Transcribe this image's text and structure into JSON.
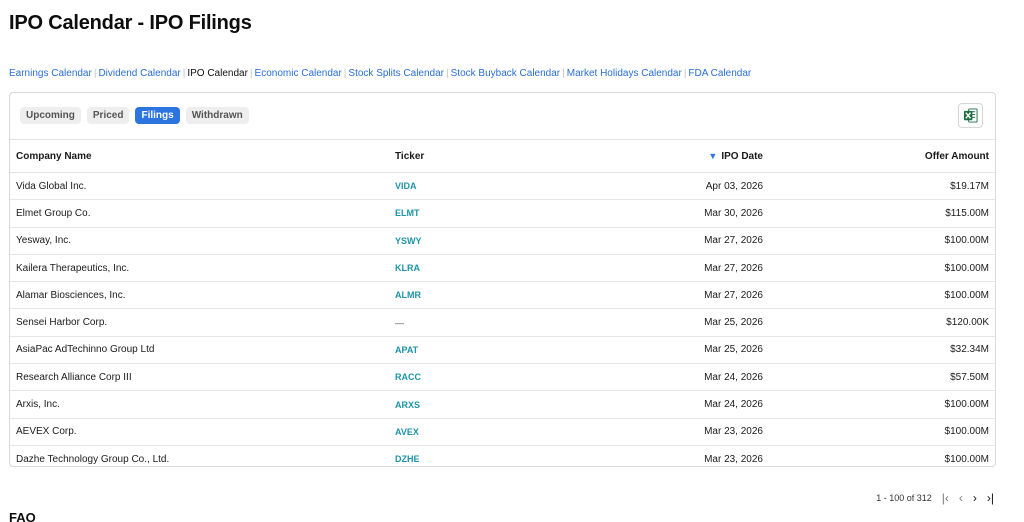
{
  "page": {
    "title": "IPO Calendar - IPO Filings"
  },
  "nav": [
    {
      "label": "Earnings Calendar",
      "active": false
    },
    {
      "label": "Dividend Calendar",
      "active": false
    },
    {
      "label": "IPO Calendar",
      "active": true
    },
    {
      "label": "Economic Calendar",
      "active": false
    },
    {
      "label": "Stock Splits Calendar",
      "active": false
    },
    {
      "label": "Stock Buyback Calendar",
      "active": false
    },
    {
      "label": "Market Holidays Calendar",
      "active": false
    },
    {
      "label": "FDA Calendar",
      "active": false
    }
  ],
  "tabs": [
    {
      "label": "Upcoming",
      "active": false
    },
    {
      "label": "Priced",
      "active": false
    },
    {
      "label": "Filings",
      "active": true
    },
    {
      "label": "Withdrawn",
      "active": false
    }
  ],
  "export": {
    "icon": "excel-icon"
  },
  "table": {
    "headers": {
      "company": "Company Name",
      "ticker": "Ticker",
      "date": "IPO Date",
      "amount": "Offer Amount"
    },
    "sort_icon": "sort-down-icon",
    "rows": [
      {
        "company": "Vida Global Inc.",
        "ticker": "VIDA",
        "date": "Apr 03, 2026",
        "amount": "$19.17M"
      },
      {
        "company": "Elmet Group Co.",
        "ticker": "ELMT",
        "date": "Mar 30, 2026",
        "amount": "$115.00M"
      },
      {
        "company": "Yesway, Inc.",
        "ticker": "YSWY",
        "date": "Mar 27, 2026",
        "amount": "$100.00M"
      },
      {
        "company": "Kailera Therapeutics, Inc.",
        "ticker": "KLRA",
        "date": "Mar 27, 2026",
        "amount": "$100.00M"
      },
      {
        "company": "Alamar Biosciences, Inc.",
        "ticker": "ALMR",
        "date": "Mar 27, 2026",
        "amount": "$100.00M"
      },
      {
        "company": "Sensei Harbor Corp.",
        "ticker": "—",
        "date": "Mar 25, 2026",
        "amount": "$120.00K"
      },
      {
        "company": "AsiaPac AdTechinno Group Ltd",
        "ticker": "APAT",
        "date": "Mar 25, 2026",
        "amount": "$32.34M"
      },
      {
        "company": "Research Alliance Corp III",
        "ticker": "RACC",
        "date": "Mar 24, 2026",
        "amount": "$57.50M"
      },
      {
        "company": "Arxis, Inc.",
        "ticker": "ARXS",
        "date": "Mar 24, 2026",
        "amount": "$100.00M"
      },
      {
        "company": "AEVEX Corp.",
        "ticker": "AVEX",
        "date": "Mar 23, 2026",
        "amount": "$100.00M"
      },
      {
        "company": "Dazhe Technology Group Co., Ltd.",
        "ticker": "DZHE",
        "date": "Mar 23, 2026",
        "amount": "$100.00M"
      }
    ]
  },
  "pagination": {
    "summary": "1 - 100 of 312",
    "first": "|‹",
    "prev": "‹",
    "next": "›",
    "last": "›|"
  },
  "faq": {
    "title": "FAQ"
  },
  "colors": {
    "accent": "#2c75e0",
    "ticker": "#1e94a8",
    "link": "#2a6fd6",
    "excel": "#1d6f42"
  }
}
